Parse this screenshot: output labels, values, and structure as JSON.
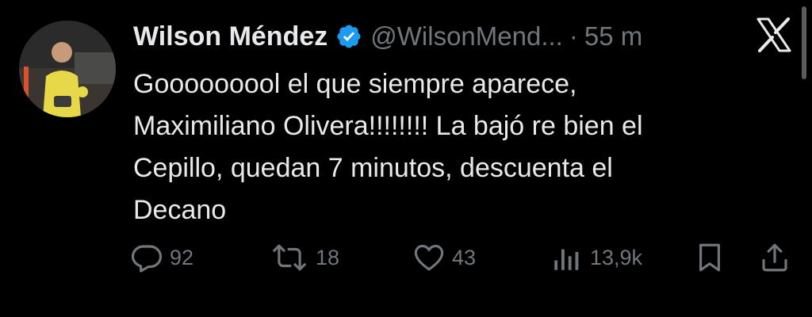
{
  "tweet": {
    "author_name": "Wilson Méndez",
    "handle": "@WilsonMend...",
    "separator": "·",
    "time": "55 m",
    "verified_icon": "verified-badge-icon",
    "text": "Gooooooool el que siempre aparece,\nMaximiliano Olivera!!!!!!!! La bajó re bien el\nCepillo, quedan 7 minutos, descuenta el\nDecano",
    "avatar_icon": "profile-photo"
  },
  "actions": {
    "replies": "92",
    "reposts": "18",
    "likes": "43",
    "views": "13,9k"
  },
  "colors": {
    "background": "#000000",
    "text": "#e7e9ea",
    "muted": "#71767b",
    "verified": "#1d9bf0"
  }
}
